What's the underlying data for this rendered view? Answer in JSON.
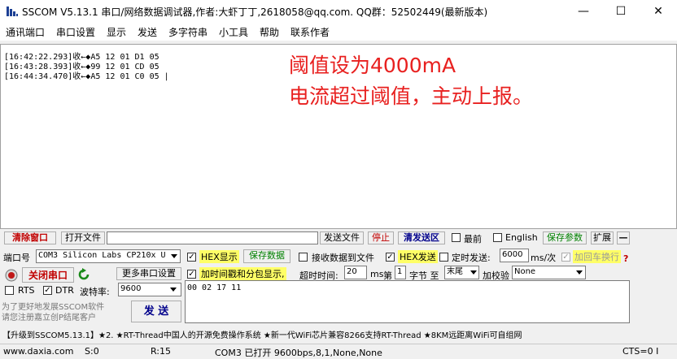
{
  "window": {
    "title": "SSCOM V5.13.1 串口/网络数据调试器,作者:大虾丁丁,2618058@qq.com. QQ群：52502449(最新版本)",
    "minimize": "—",
    "maximize": "☐",
    "close": "✕"
  },
  "menu": [
    "通讯端口",
    "串口设置",
    "显示",
    "发送",
    "多字符串",
    "小工具",
    "帮助",
    "联系作者"
  ],
  "receive": {
    "lines": [
      "[16:42:22.293]收←◆A5 12 01 D1 05",
      "[16:43:28.393]收←◆99 12 01 CD 05",
      "[16:44:34.470]收←◆A5 12 01 C0 05 |"
    ],
    "annotation": [
      "阈值设为4000mA",
      "电流超过阈值，主动上报。"
    ]
  },
  "toolbar1": {
    "clear_window": "清除窗口",
    "open_file": "打开文件",
    "send_file": "发送文件",
    "stop": "停止",
    "clear_send": "清发送区",
    "topmost": "最前",
    "english": "English",
    "save_params": "保存参数",
    "expand": "扩展",
    "collapse": "—"
  },
  "port": {
    "label": "端口号",
    "value": "COM3 Silicon Labs CP210x U",
    "close_port": "关闭串口",
    "more_settings": "更多串口设置",
    "rts": "RTS",
    "dtr": "DTR",
    "baud_label": "波特率:",
    "baud_value": "9600"
  },
  "options": {
    "hex_display": "HEX显示",
    "save_data": "保存数据",
    "recv_to_file": "接收数据到文件",
    "hex_send": "HEX发送",
    "timed_send": "定时发送:",
    "interval": "6000",
    "interval_unit": "ms/次",
    "add_crlf": "加回车换行",
    "timestamp": "加时间戳和分包显示,",
    "timeout_label": "超时时间:",
    "timeout_value": "20",
    "timeout_unit": "ms",
    "nth": "第",
    "byte_index": "1",
    "byte_to": "字节 至",
    "byte_end": "末尾",
    "checksum_label": "加校验",
    "checksum_value": "None",
    "help_mark": "?"
  },
  "send": {
    "content": "00 02 17 11",
    "button": "发 送"
  },
  "promo": {
    "left": "为了更好地发展SSCOM软件\n请您注册嘉立创P结尾客户",
    "ticker": "【升级到SSCOM5.13.1】★2. ★RT-Thread中国人的开源免费操作系统 ★新一代WiFi芯片兼容8266支持RT-Thread ★8KM远距离WiFi可自组网"
  },
  "status": {
    "url": "www.daxia.com",
    "sent": "S:0",
    "received": "R:15",
    "port_info": "COM3 已打开  9600bps,8,1,None,None",
    "cts": "CTS=0 I"
  }
}
